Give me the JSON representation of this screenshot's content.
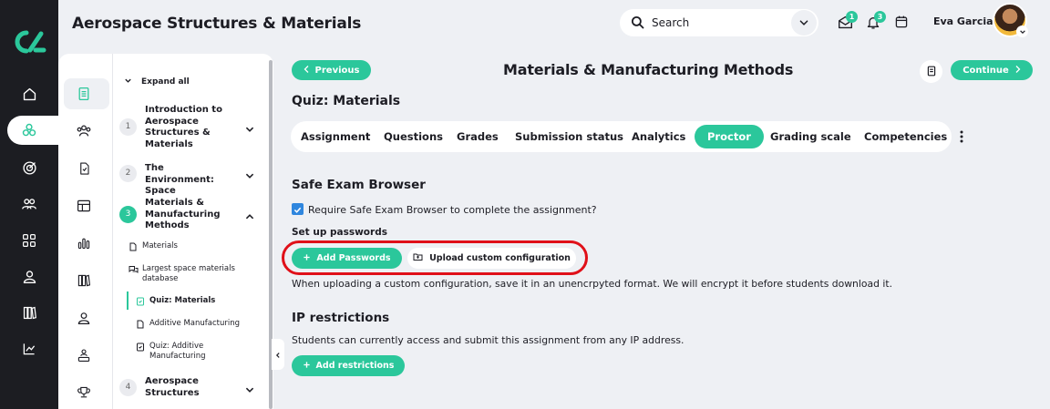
{
  "app": {
    "course_title": "Aerospace Structures & Materials"
  },
  "header": {
    "search_placeholder": "Search",
    "inbox_badge": "1",
    "notifications_badge": "3",
    "user_name": "Eva Garcia"
  },
  "course_nav": {
    "expand_all": "Expand all",
    "sections": [
      {
        "num": "1",
        "title": "Introduction to Aerospace Structures & Materials"
      },
      {
        "num": "2",
        "title": "The Environment: Space"
      },
      {
        "num": "3",
        "title": "Materials & Manufacturing Methods"
      },
      {
        "num": "4",
        "title": "Aerospace Structures"
      }
    ],
    "items": [
      {
        "label": "Materials"
      },
      {
        "label": "Largest space materials database"
      },
      {
        "label": "Quiz: Materials"
      },
      {
        "label": "Additive Manufacturing"
      },
      {
        "label": "Quiz: Additive Manufacturing"
      }
    ]
  },
  "main": {
    "previous_label": "Previous",
    "continue_label": "Continue",
    "page_title": "Materials & Manufacturing Methods",
    "quiz_title": "Quiz: Materials",
    "tabs": [
      {
        "label": "Assignment"
      },
      {
        "label": "Questions"
      },
      {
        "label": "Grades"
      },
      {
        "label": "Submission status"
      },
      {
        "label": "Analytics"
      },
      {
        "label": "Proctor"
      },
      {
        "label": "Grading scale"
      },
      {
        "label": "Competencies"
      }
    ],
    "active_tab": "Proctor",
    "seb_heading": "Safe Exam Browser",
    "seb_checkbox_label": "Require Safe Exam Browser to complete the assignment?",
    "seb_checked": true,
    "passwords_heading": "Set up passwords",
    "add_passwords_label": "Add Passwords",
    "upload_config_label": "Upload custom configuration",
    "upload_note": "When uploading a custom configuration, save it in an unencrpyted format. We will encrypt it before students download it.",
    "ip_heading": "IP restrictions",
    "ip_note": "Students can currently access and submit this assignment from any IP address.",
    "add_restrictions_label": "Add restrictions"
  },
  "colors": {
    "accent": "#2bc79b",
    "rail": "#1c1d22",
    "highlight": "#e01019",
    "checkbox": "#2f86de"
  }
}
